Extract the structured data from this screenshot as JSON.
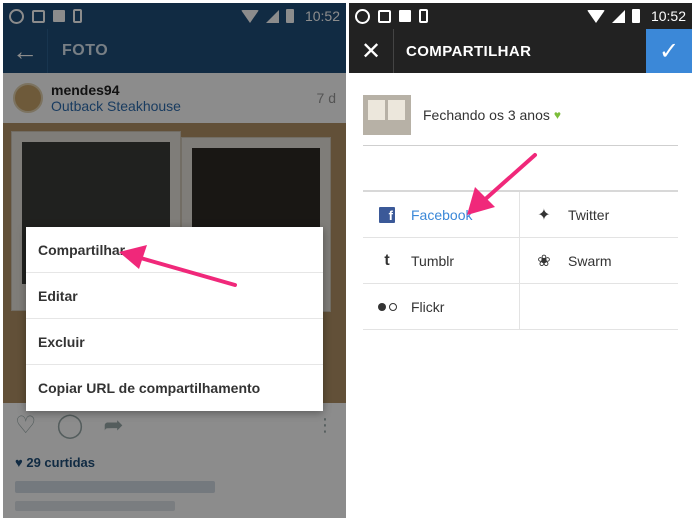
{
  "status": {
    "time": "10:52"
  },
  "left": {
    "title": "FOTO",
    "user": {
      "name": "mendes94",
      "location": "Outback Steakhouse",
      "age": "7 d"
    },
    "menu": [
      {
        "label": "Compartilhar"
      },
      {
        "label": "Editar"
      },
      {
        "label": "Excluir"
      },
      {
        "label": "Copiar URL de compartilhamento"
      }
    ],
    "likes": "29 curtidas"
  },
  "right": {
    "title": "COMPARTILHAR",
    "caption": "Fechando os 3 anos",
    "share": [
      {
        "label": "Facebook",
        "icon": "facebook-icon"
      },
      {
        "label": "Twitter",
        "icon": "twitter-icon"
      },
      {
        "label": "Tumblr",
        "icon": "tumblr-icon"
      },
      {
        "label": "Swarm",
        "icon": "swarm-icon"
      },
      {
        "label": "Flickr",
        "icon": "flickr-icon"
      }
    ]
  },
  "colors": {
    "instagram_bar": "#1f4f7a",
    "share_bar": "#222222",
    "confirm": "#3b88d8",
    "arrow": "#f0287a"
  }
}
